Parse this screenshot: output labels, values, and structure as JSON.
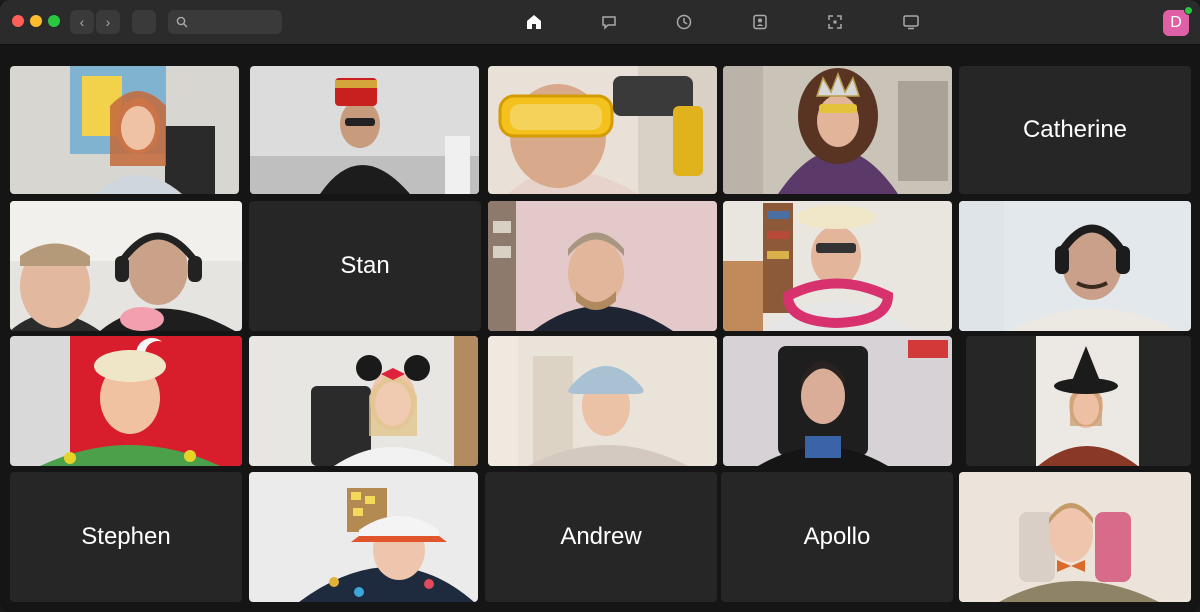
{
  "colors": {
    "accent": "#e060a8",
    "online": "#28c840",
    "tile_bg": "#262626"
  },
  "toolbar": {
    "back_label": "‹",
    "forward_label": "›",
    "search_placeholder": "",
    "icons": [
      "home-icon",
      "chat-icon",
      "clock-icon",
      "contacts-icon",
      "apps-icon",
      "screen-share-icon"
    ]
  },
  "user": {
    "avatar_initial": "D"
  },
  "participants": [
    {
      "name": "Catherine",
      "video": false
    },
    {
      "name": "Stan",
      "video": false
    },
    {
      "name": "Stephen",
      "video": false
    },
    {
      "name": "Andrew",
      "video": false
    },
    {
      "name": "Apollo",
      "video": false
    }
  ],
  "video_scenes": [
    {
      "label": "participant-video-1"
    },
    {
      "label": "participant-video-2"
    },
    {
      "label": "participant-video-3"
    },
    {
      "label": "participant-video-4"
    },
    {
      "label": "participant-video-5"
    },
    {
      "label": "participant-video-6"
    },
    {
      "label": "participant-video-7"
    },
    {
      "label": "participant-video-8"
    },
    {
      "label": "participant-video-9"
    },
    {
      "label": "participant-video-10"
    },
    {
      "label": "participant-video-11"
    },
    {
      "label": "participant-video-12"
    },
    {
      "label": "participant-video-13"
    },
    {
      "label": "participant-video-14"
    },
    {
      "label": "participant-video-15"
    }
  ]
}
